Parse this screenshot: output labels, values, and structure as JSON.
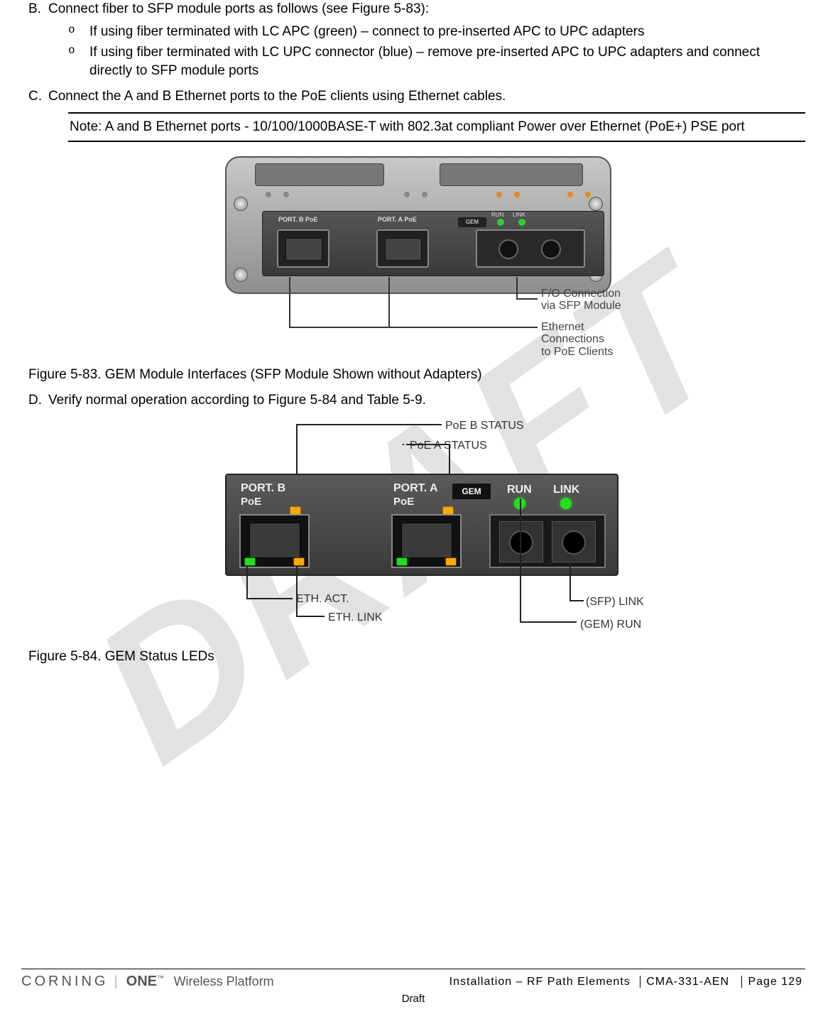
{
  "watermark": "DRAFT",
  "steps": {
    "B": {
      "letter": "B.",
      "text": "Connect fiber to SFP module ports as follows (see Figure 5-83):",
      "sub": [
        "If using fiber terminated with LC APC (green) – connect to pre-inserted APC to UPC adapters",
        "If using fiber terminated with LC UPC connector (blue) – remove pre-inserted APC to UPC adapters and connect directly to SFP module ports"
      ]
    },
    "C": {
      "letter": "C.",
      "text": "Connect the A and B Ethernet ports to the PoE clients using Ethernet cables.",
      "note": "Note: A and B Ethernet ports - 10/100/1000BASE-T with 802.3at compliant Power over Ethernet (PoE+) PSE port"
    },
    "D": {
      "letter": "D.",
      "text": "Verify normal operation according to Figure 5-84 and Table 5-9."
    }
  },
  "figure83": {
    "caption": "Figure 5-83. GEM Module Interfaces (SFP Module Shown without Adapters)",
    "labels": {
      "portB": "PORT. B PoE",
      "portA": "PORT. A PoE",
      "gem": "GEM",
      "run": "RUN",
      "link": "LINK"
    },
    "annotations": {
      "fo_line1": "F/O Connection",
      "fo_line2": "via SFP Module",
      "eth_line1": "Ethernet Connections",
      "eth_line2": "to PoE Clients"
    }
  },
  "figure84": {
    "caption": "Figure 5-84. GEM Status LEDs",
    "labels": {
      "portB": "PORT. B",
      "portA": "PORT. A",
      "poe": "PoE",
      "gem": "GEM",
      "run": "RUN",
      "link": "LINK"
    },
    "annotations": {
      "poe_b": "PoE B STATUS",
      "poe_a": "PoE A STATUS",
      "eth_act": "ETH. ACT.",
      "eth_link": "ETH. LINK",
      "sfp_link": "(SFP) LINK",
      "gem_run": "(GEM) RUN"
    }
  },
  "footer": {
    "brand": {
      "corning": "CORNING",
      "one": "ONE",
      "tm": "™",
      "platform": "Wireless Platform"
    },
    "section": "Installation – RF Path Elements",
    "docnum": "CMA-331-AEN",
    "page": "Page 129",
    "draft": "Draft"
  }
}
